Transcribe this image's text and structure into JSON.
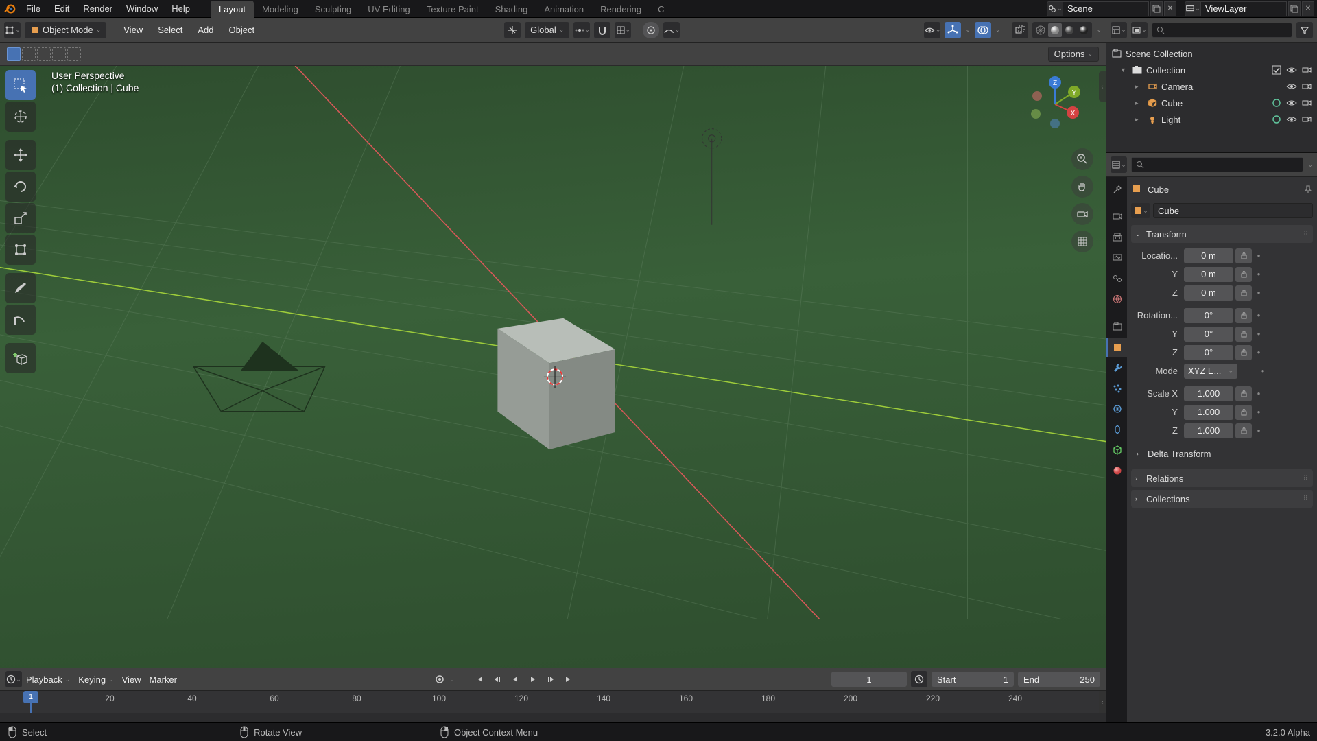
{
  "menus": {
    "file": "File",
    "edit": "Edit",
    "render": "Render",
    "window": "Window",
    "help": "Help"
  },
  "workspaces": {
    "layout": "Layout",
    "modeling": "Modeling",
    "sculpting": "Sculpting",
    "uv": "UV Editing",
    "texpaint": "Texture Paint",
    "shading": "Shading",
    "animation": "Animation",
    "rendering": "Rendering",
    "more": "C"
  },
  "scene_name": "Scene",
  "viewlayer_name": "ViewLayer",
  "mode": "Object Mode",
  "view_menu": {
    "view": "View",
    "select": "Select",
    "add": "Add",
    "object": "Object"
  },
  "orientation": "Global",
  "options_label": "Options",
  "overlay": {
    "perspective": "User Perspective",
    "path": "(1) Collection | Cube"
  },
  "timeline": {
    "playback": "Playback",
    "keying": "Keying",
    "view": "View",
    "marker": "Marker",
    "frame": "1",
    "start_lbl": "Start",
    "start": "1",
    "end_lbl": "End",
    "end": "250",
    "marks": [
      "20",
      "40",
      "60",
      "80",
      "100",
      "120",
      "140",
      "160",
      "180",
      "200",
      "220",
      "240"
    ]
  },
  "outliner": {
    "root": "Scene Collection",
    "coll": "Collection",
    "items": [
      {
        "name": "Camera",
        "icon": "camera",
        "color": "#e79e4f"
      },
      {
        "name": "Cube",
        "icon": "mesh",
        "color": "#e79e4f",
        "data": true
      },
      {
        "name": "Light",
        "icon": "light",
        "color": "#e79e4f",
        "data": true
      }
    ]
  },
  "props": {
    "breadcrumb": "Cube",
    "obj_name": "Cube",
    "transform": "Transform",
    "loc_lbl": "Locatio...",
    "rot_lbl": "Rotation...",
    "scale_lbl": "Scale X",
    "y": "Y",
    "z": "Z",
    "mode_lbl": "Mode",
    "mode_val": "XYZ E...",
    "loc": [
      "0 m",
      "0 m",
      "0 m"
    ],
    "rot": [
      "0°",
      "0°",
      "0°"
    ],
    "scale": [
      "1.000",
      "1.000",
      "1.000"
    ],
    "delta": "Delta Transform",
    "relations": "Relations",
    "collections": "Collections"
  },
  "status": {
    "select": "Select",
    "rotate": "Rotate View",
    "ctx": "Object Context Menu",
    "version": "3.2.0 Alpha"
  }
}
